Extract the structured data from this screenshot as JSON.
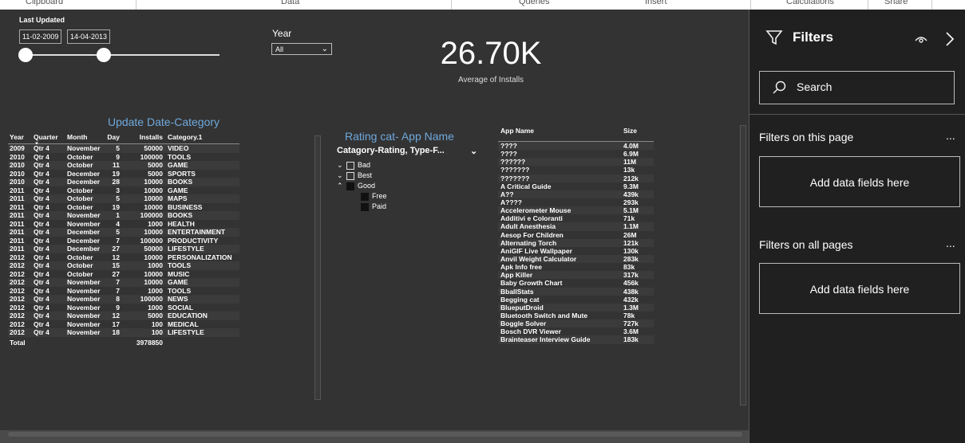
{
  "ribbon": {
    "tabs": [
      "Clipboard",
      "Data",
      "Queries",
      "Insert",
      "Calculations",
      "Share"
    ]
  },
  "slicer": {
    "title": "Last Updated",
    "start_date": "11-02-2009",
    "end_date": "14-04-2013"
  },
  "year_filter": {
    "label": "Year",
    "selected": "All"
  },
  "kpi": {
    "value": "26.70K",
    "label": "Average of Installs"
  },
  "update_table": {
    "title": "Update Date-Category",
    "columns": [
      "Year",
      "Quarter",
      "Month",
      "Day",
      "Installs",
      "Category.1"
    ],
    "rows": [
      [
        "2009",
        "Qtr 4",
        "November",
        "5",
        "50000",
        "VIDEO"
      ],
      [
        "2010",
        "Qtr 4",
        "October",
        "9",
        "100000",
        "TOOLS"
      ],
      [
        "2010",
        "Qtr 4",
        "October",
        "11",
        "5000",
        "GAME"
      ],
      [
        "2010",
        "Qtr 4",
        "December",
        "19",
        "5000",
        "SPORTS"
      ],
      [
        "2010",
        "Qtr 4",
        "December",
        "28",
        "10000",
        "BOOKS"
      ],
      [
        "2011",
        "Qtr 4",
        "October",
        "3",
        "10000",
        "GAME"
      ],
      [
        "2011",
        "Qtr 4",
        "October",
        "5",
        "10000",
        "MAPS"
      ],
      [
        "2011",
        "Qtr 4",
        "October",
        "19",
        "10000",
        "BUSINESS"
      ],
      [
        "2011",
        "Qtr 4",
        "November",
        "1",
        "100000",
        "BOOKS"
      ],
      [
        "2011",
        "Qtr 4",
        "November",
        "4",
        "1000",
        "HEALTH"
      ],
      [
        "2011",
        "Qtr 4",
        "December",
        "5",
        "10000",
        "ENTERTAINMENT"
      ],
      [
        "2011",
        "Qtr 4",
        "December",
        "7",
        "100000",
        "PRODUCTIVITY"
      ],
      [
        "2011",
        "Qtr 4",
        "December",
        "27",
        "50000",
        "LIFESTYLE"
      ],
      [
        "2012",
        "Qtr 4",
        "October",
        "12",
        "10000",
        "PERSONALIZATION"
      ],
      [
        "2012",
        "Qtr 4",
        "October",
        "15",
        "1000",
        "TOOLS"
      ],
      [
        "2012",
        "Qtr 4",
        "October",
        "27",
        "10000",
        "MUSIC"
      ],
      [
        "2012",
        "Qtr 4",
        "November",
        "7",
        "10000",
        "GAME"
      ],
      [
        "2012",
        "Qtr 4",
        "November",
        "7",
        "1000",
        "TOOLS"
      ],
      [
        "2012",
        "Qtr 4",
        "November",
        "8",
        "100000",
        "NEWS"
      ],
      [
        "2012",
        "Qtr 4",
        "November",
        "9",
        "1000",
        "SOCIAL"
      ],
      [
        "2012",
        "Qtr 4",
        "November",
        "12",
        "5000",
        "EDUCATION"
      ],
      [
        "2012",
        "Qtr 4",
        "November",
        "17",
        "100",
        "MEDICAL"
      ],
      [
        "2012",
        "Qtr 4",
        "November",
        "18",
        "100",
        "LIFESTYLE"
      ]
    ],
    "total_label": "Total",
    "total_value": "3978850"
  },
  "rating_slicer": {
    "title": "Rating cat- App Name",
    "header": "Catagory-Rating, Type-F...",
    "nodes": [
      {
        "label": "Bad",
        "expanded": false
      },
      {
        "label": "Best",
        "expanded": false
      },
      {
        "label": "Good",
        "expanded": true,
        "children": [
          "Free",
          "Paid"
        ]
      }
    ]
  },
  "app_table": {
    "columns": [
      "App Name",
      "Size"
    ],
    "rows": [
      [
        "????",
        "4.0M"
      ],
      [
        "????",
        "6.9M"
      ],
      [
        "??????",
        "11M"
      ],
      [
        "???????",
        "13k"
      ],
      [
        "???????",
        "212k"
      ],
      [
        "A Critical Guide",
        "9.3M"
      ],
      [
        "A??",
        "439k"
      ],
      [
        "A????",
        "293k"
      ],
      [
        "Accelerometer Mouse",
        "5.1M"
      ],
      [
        "Additivi e Coloranti",
        "71k"
      ],
      [
        "Adult Anesthesia",
        "1.1M"
      ],
      [
        "Aesop For Children",
        "26M"
      ],
      [
        "Alternating Torch",
        "121k"
      ],
      [
        "AniGIF Live Wallpaper",
        "130k"
      ],
      [
        "Anvil Weight Calculator",
        "283k"
      ],
      [
        "Apk Info free",
        "83k"
      ],
      [
        "App Killer",
        "317k"
      ],
      [
        "Baby Growth Chart",
        "456k"
      ],
      [
        "BballStats",
        "438k"
      ],
      [
        "Begging cat",
        "432k"
      ],
      [
        "BlueputDroid",
        "1.3M"
      ],
      [
        "Bluetooth Switch and Mute",
        "78k"
      ],
      [
        "Boggle Solver",
        "727k"
      ],
      [
        "Bosch DVR Viewer",
        "3.6M"
      ],
      [
        "Brainteaser Interview Guide",
        "183k"
      ]
    ]
  },
  "filters_pane": {
    "title": "Filters",
    "search_placeholder": "Search",
    "section_page": "Filters on this page",
    "section_all": "Filters on all pages",
    "add_fields": "Add data fields here",
    "more": "..."
  }
}
